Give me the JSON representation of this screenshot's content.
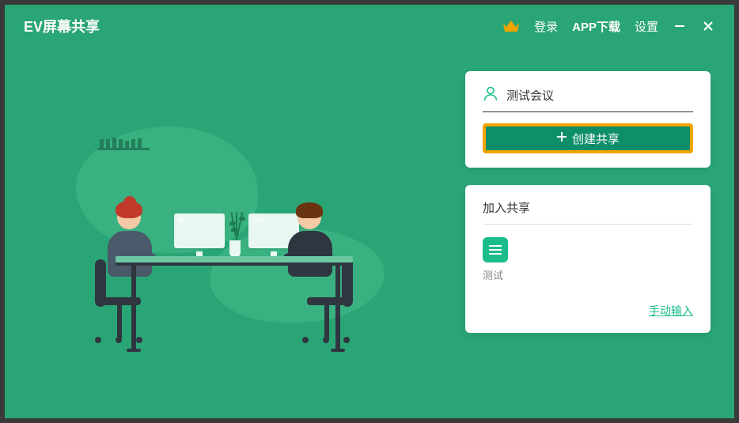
{
  "header": {
    "app_title": "EV屏幕共享",
    "login_label": "登录",
    "download_label": "APP下载",
    "settings_label": "设置"
  },
  "create_card": {
    "meeting_name_value": "测试会议",
    "create_button_label": "创建共享"
  },
  "join_card": {
    "title": "加入共享",
    "session_label": "测试",
    "manual_input_link": "手动输入"
  },
  "colors": {
    "bg": "#2aa575",
    "accent": "#1abc8c",
    "highlight_border": "#f0a400"
  }
}
